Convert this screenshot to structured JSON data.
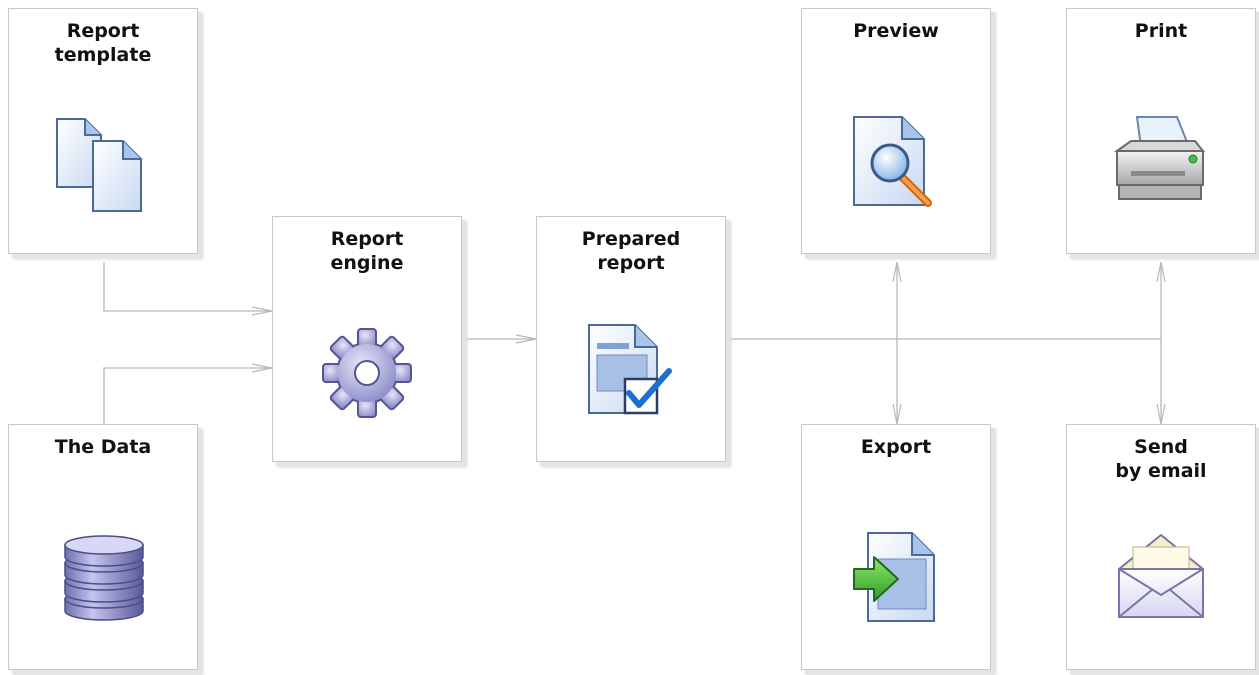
{
  "diagram": {
    "nodes": {
      "report_template": {
        "label": "Report\ntemplate",
        "icon": "documents-icon"
      },
      "the_data": {
        "label": "The Data",
        "icon": "database-icon"
      },
      "report_engine": {
        "label": "Report\nengine",
        "icon": "gear-icon"
      },
      "prepared_report": {
        "label": "Prepared\nreport",
        "icon": "checked-document-icon"
      },
      "preview": {
        "label": "Preview",
        "icon": "magnifier-document-icon"
      },
      "print": {
        "label": "Print",
        "icon": "printer-icon"
      },
      "export": {
        "label": "Export",
        "icon": "export-document-icon"
      },
      "send_by_email": {
        "label": "Send\nby email",
        "icon": "envelope-icon"
      }
    },
    "edges": [
      {
        "from": "report_template",
        "to": "report_engine"
      },
      {
        "from": "the_data",
        "to": "report_engine"
      },
      {
        "from": "report_engine",
        "to": "prepared_report"
      },
      {
        "from": "prepared_report",
        "to": "preview"
      },
      {
        "from": "prepared_report",
        "to": "export"
      },
      {
        "from": "prepared_report",
        "to": "print"
      },
      {
        "from": "prepared_report",
        "to": "send_by_email"
      }
    ],
    "colors": {
      "connector": "#b8b8b8",
      "box_border": "#c8c8c8",
      "title": "#111111"
    }
  }
}
